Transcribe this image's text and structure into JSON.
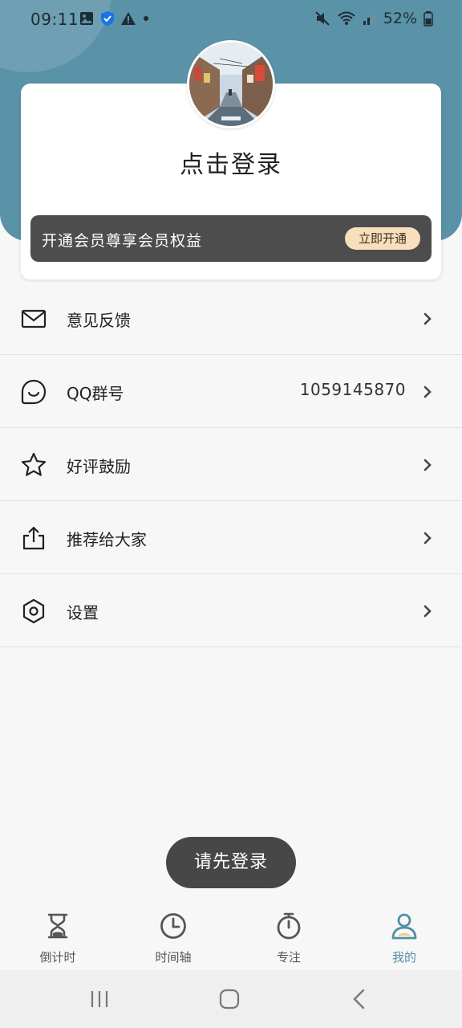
{
  "status_bar": {
    "time": "09:11",
    "battery": "52%"
  },
  "profile": {
    "login_title": "点击登录",
    "vip_text": "开通会员尊享会员权益",
    "vip_button": "立即开通"
  },
  "menu": [
    {
      "label": "意见反馈",
      "icon": "mail-icon",
      "value": ""
    },
    {
      "label": "QQ群号",
      "icon": "chat-face-icon",
      "value": "1059145870"
    },
    {
      "label": "好评鼓励",
      "icon": "star-icon",
      "value": ""
    },
    {
      "label": "推荐给大家",
      "icon": "share-icon",
      "value": ""
    },
    {
      "label": "设置",
      "icon": "settings-hexagon-icon",
      "value": ""
    }
  ],
  "toast": "请先登录",
  "bottom_nav": [
    {
      "label": "倒计时",
      "icon": "hourglass-icon",
      "active": false
    },
    {
      "label": "时间轴",
      "icon": "clock-icon",
      "active": false
    },
    {
      "label": "专注",
      "icon": "stopwatch-icon",
      "active": false
    },
    {
      "label": "我的",
      "icon": "person-icon",
      "active": true
    }
  ],
  "colors": {
    "header": "#5a92a8",
    "vip_banner": "#4d4d4d",
    "vip_button": "#f7dfbd",
    "active_tab": "#4f8fa6"
  }
}
